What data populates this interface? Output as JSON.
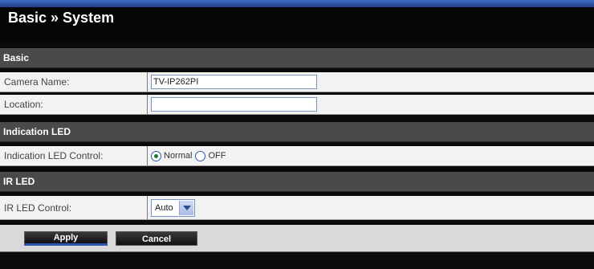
{
  "page": {
    "title": "Basic » System"
  },
  "sections": {
    "basic": {
      "label": "Basic"
    },
    "indication_led": {
      "label": "Indication LED"
    },
    "ir_led": {
      "label": "IR LED"
    }
  },
  "fields": {
    "camera_name": {
      "label": "Camera Name:",
      "value": "TV-IP262PI"
    },
    "location": {
      "label": "Location:",
      "value": ""
    },
    "indication_led_control": {
      "label": "Indication LED Control:",
      "options": [
        "Normal",
        "OFF"
      ],
      "selected": "Normal"
    },
    "ir_led_control": {
      "label": "IR LED Control:",
      "value": "Auto"
    }
  },
  "buttons": {
    "apply": "Apply",
    "cancel": "Cancel"
  },
  "colors": {
    "section_bg": "#4a4a4a",
    "field_bg": "#f2f2f2",
    "accent": "#2b55b0",
    "header_bg": "#050505"
  }
}
